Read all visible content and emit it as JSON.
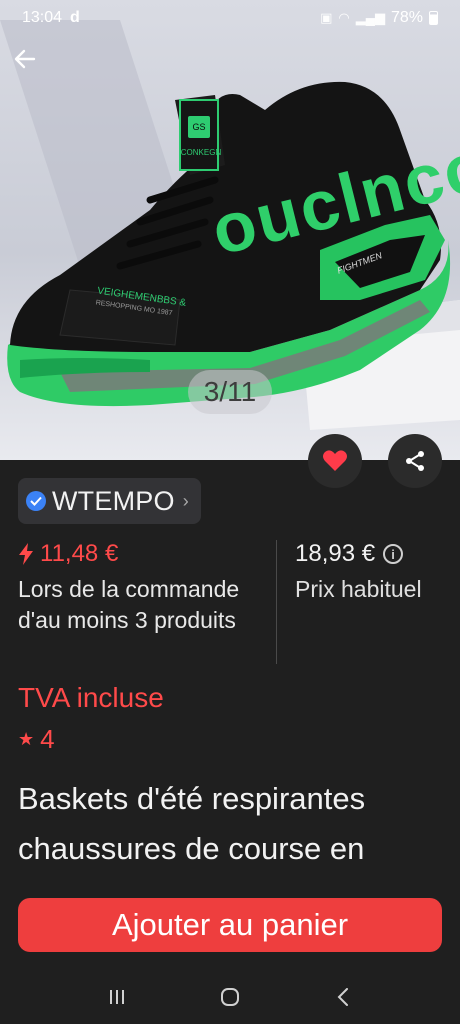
{
  "status_bar": {
    "time": "13:04",
    "carrier_glyph": "d",
    "battery": "78%"
  },
  "image_counter": "3/11",
  "shoe_print": {
    "tongue": "CONKEGN",
    "tongue_badge": "GS",
    "side_text": "ouclnco",
    "side_panel": "VEIGHEMENBBS &",
    "side_panel_small": "RESHOPPING MO 1987",
    "heel_print": "FIGHTMEN"
  },
  "store": {
    "name": "WTEMPO",
    "verified": true
  },
  "pricing": {
    "flash_price": "11,48 €",
    "flash_note": "Lors de la commande d'au moins 3 produits",
    "regular_price": "18,93 €",
    "regular_label": "Prix habituel"
  },
  "vat_label": "TVA incluse",
  "rating": "4",
  "product_title": "Baskets d'été respirantes chaussures de course en",
  "cta_label": "Ajouter au panier",
  "colors": {
    "accent_red": "#ee3e3e",
    "price_red": "#ff4a4a",
    "shoe_green": "#22c55e",
    "background": "#1f1f1f"
  },
  "icons": [
    "arrow-left-icon",
    "heart-icon",
    "share-icon",
    "verified-icon",
    "chevron-right-icon",
    "flash-icon",
    "info-icon",
    "star-icon",
    "recents-icon",
    "home-icon",
    "back-nav-icon"
  ]
}
